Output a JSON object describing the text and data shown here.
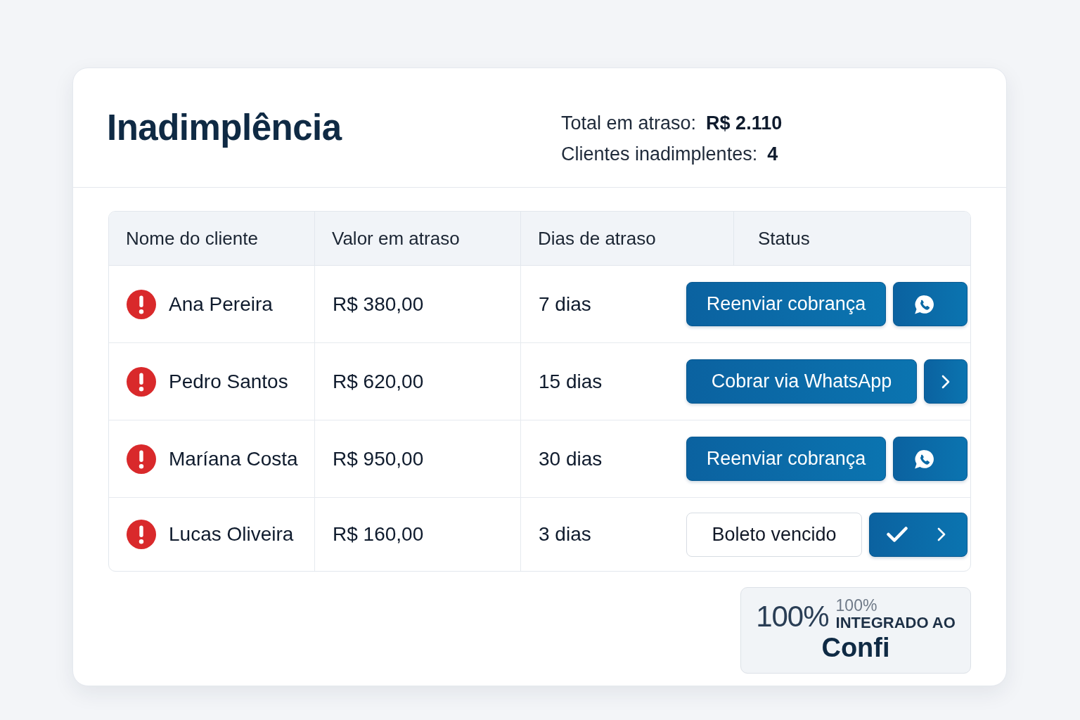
{
  "header": {
    "title": "Inadimplência",
    "summary": [
      {
        "label": "Total em atraso:",
        "value": "R$ 2.110"
      },
      {
        "label": "Clientes inadimplentes:",
        "value": "4"
      }
    ]
  },
  "table": {
    "columns": [
      "Nome do cliente",
      "Valor em atraso",
      "Dias de atraso",
      "Status"
    ],
    "rows": [
      {
        "client": "Ana Pereira",
        "amount": "R$ 380,00",
        "days": "7 dias",
        "actions": [
          {
            "kind": "primary",
            "label": "Reenviar cobrança"
          },
          {
            "kind": "chat"
          }
        ]
      },
      {
        "client": "Pedro Santos",
        "amount": "R$ 620,00",
        "days": "15 dias",
        "actions": [
          {
            "kind": "primary",
            "label": "Cobrar via WhatsApp"
          },
          {
            "kind": "next"
          }
        ]
      },
      {
        "client": "Maríana Costa",
        "amount": "R$ 950,00",
        "days": "30 dias",
        "actions": [
          {
            "kind": "primary",
            "label": "Reenviar cobrança"
          },
          {
            "kind": "chat"
          }
        ]
      },
      {
        "client": "Lucas Oliveira",
        "amount": "R$ 160,00",
        "days": "3 dias",
        "actions": [
          {
            "kind": "outline",
            "label": "Boleto vencido"
          },
          {
            "kind": "confirm_next"
          }
        ]
      }
    ]
  },
  "integration_badge": {
    "percent": "100%",
    "percent_small": "100%",
    "caption": "INTEGRADO AO",
    "brand": "Confi"
  }
}
